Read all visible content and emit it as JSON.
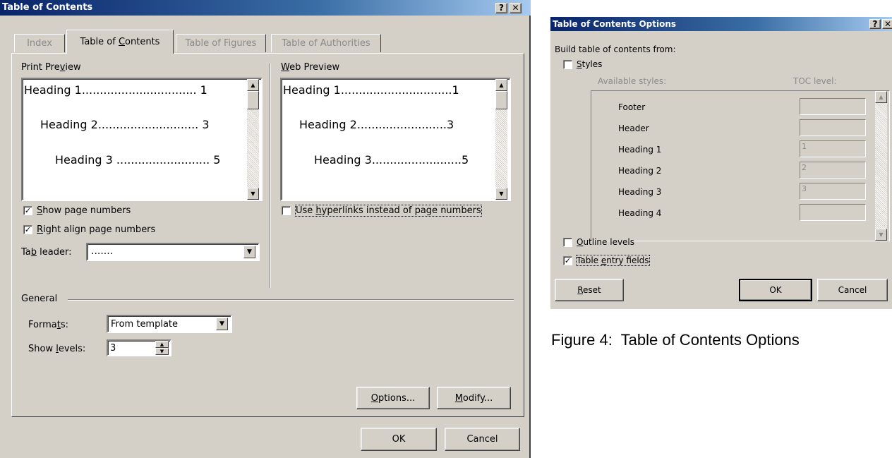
{
  "toc_dialog": {
    "title": "Table of Contents",
    "help_btn": "?",
    "close_btn": "✕",
    "tabs": [
      "Index",
      "Table of Contents",
      "Table of Figures",
      "Table of Authorities"
    ],
    "print_preview_label": "Print Preview",
    "web_preview_label": "Web Preview",
    "print_preview": [
      {
        "text": "Heading 1",
        "dots": "................................",
        "page": "1"
      },
      {
        "text": "Heading 2",
        "dots": ".............................",
        "page": "3"
      },
      {
        "text": "Heading 3",
        "dots": "..........................",
        "page": "5"
      }
    ],
    "web_preview": [
      {
        "text": "Heading 1",
        "dots": "...............................",
        "page": "1"
      },
      {
        "text": "Heading 2",
        "dots": ".........................",
        "page": "3"
      },
      {
        "text": "Heading 3",
        "dots": ".........................",
        "page": "5"
      }
    ],
    "show_page_numbers": "Show page numbers",
    "right_align": "Right align page numbers",
    "use_hyperlinks": "Use hyperlinks instead of page numbers",
    "tab_leader_label": "Tab leader:",
    "tab_leader_value": ".......",
    "general_label": "General",
    "formats_label": "Formats:",
    "formats_value": "From template",
    "show_levels_label": "Show levels:",
    "show_levels_value": "3",
    "options_btn": "Options...",
    "modify_btn": "Modify...",
    "ok_btn": "OK",
    "cancel_btn": "Cancel"
  },
  "options_dialog": {
    "title": "Table of Contents Options",
    "help_btn": "?",
    "close_btn": "✕",
    "build_label": "Build table of contents from:",
    "styles_label": "Styles",
    "available_styles_label": "Available styles:",
    "toc_level_label": "TOC level:",
    "styles": [
      {
        "name": "Footer",
        "level": ""
      },
      {
        "name": "Header",
        "level": ""
      },
      {
        "name": "Heading 1",
        "level": "1"
      },
      {
        "name": "Heading 2",
        "level": "2"
      },
      {
        "name": "Heading 3",
        "level": "3"
      },
      {
        "name": "Heading 4",
        "level": ""
      }
    ],
    "outline_levels": "Outline levels",
    "table_entry_fields": "Table entry fields",
    "reset_btn": "Reset",
    "ok_btn": "OK",
    "cancel_btn": "Cancel"
  },
  "caption": "Figure 4:  Table of Contents Options"
}
